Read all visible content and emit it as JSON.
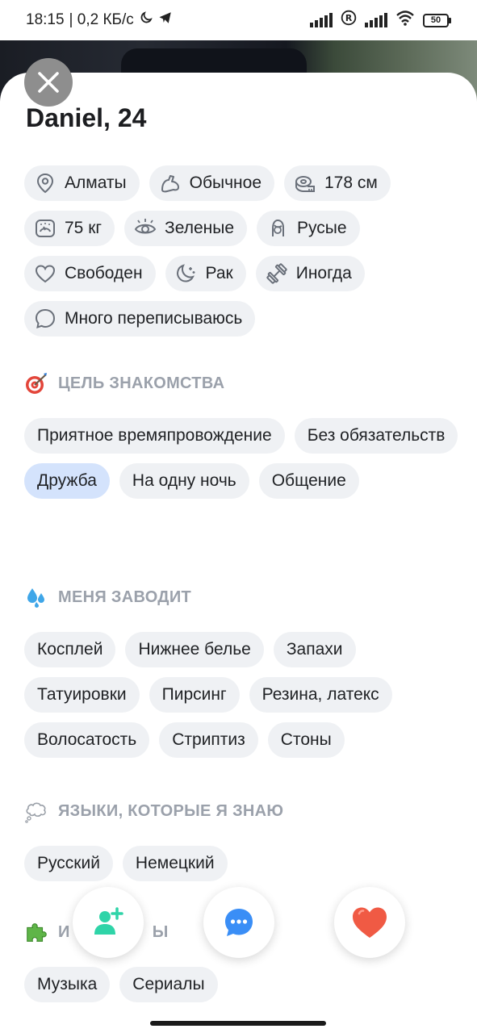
{
  "status_bar": {
    "time": "18:15",
    "network_speed": "| 0,2 КБ/с",
    "battery": "50"
  },
  "profile": {
    "name": "Daniel, 24"
  },
  "attributes": [
    {
      "icon": "location-pin-icon",
      "label": "Алматы"
    },
    {
      "icon": "body-type-icon",
      "label": "Обычное"
    },
    {
      "icon": "tape-measure-icon",
      "label": "178 см"
    },
    {
      "icon": "scale-icon",
      "label": "75 кг"
    },
    {
      "icon": "eye-icon",
      "label": "Зеленые"
    },
    {
      "icon": "hair-icon",
      "label": "Русые"
    },
    {
      "icon": "heart-outline-icon",
      "label": "Свободен"
    },
    {
      "icon": "zodiac-moon-icon",
      "label": "Рак"
    },
    {
      "icon": "dumbbell-icon",
      "label": "Иногда"
    },
    {
      "icon": "chat-bubble-icon",
      "label": "Много переписываюсь"
    }
  ],
  "goal_section": {
    "title": "ЦЕЛЬ ЗНАКОМСТВА",
    "icon": "dart-target-icon",
    "tags": [
      {
        "label": "Приятное времяпровождение",
        "active": false
      },
      {
        "label": "Без обязательств",
        "active": false
      },
      {
        "label": "Дружба",
        "active": true
      },
      {
        "label": "На одну ночь",
        "active": false
      },
      {
        "label": "Общение",
        "active": false
      }
    ]
  },
  "turn_on_section": {
    "title": "МЕНЯ ЗАВОДИТ",
    "icon": "sweat-drops-icon",
    "tags": [
      "Косплей",
      "Нижнее белье",
      "Запахи",
      "Татуировки",
      "Пирсинг",
      "Резина, латекс",
      "Волосатость",
      "Стриптиз",
      "Стоны"
    ]
  },
  "languages_section": {
    "title": "ЯЗЫКИ, КОТОРЫЕ Я ЗНАЮ",
    "icon": "thought-balloon-icon",
    "tags": [
      "Русский",
      "Немецкий"
    ]
  },
  "interests_section": {
    "title_left": "И",
    "title_right": "Ы",
    "icon": "puzzle-piece-icon",
    "tags": [
      "Музыка",
      "Сериалы"
    ]
  },
  "colors": {
    "chip_bg": "#eff1f4",
    "chip_active_bg": "#d4e3fc",
    "section_title": "#9ba1ab",
    "add_friend": "#2fd4a8",
    "message": "#3a8ef6",
    "like": "#f05a44"
  }
}
